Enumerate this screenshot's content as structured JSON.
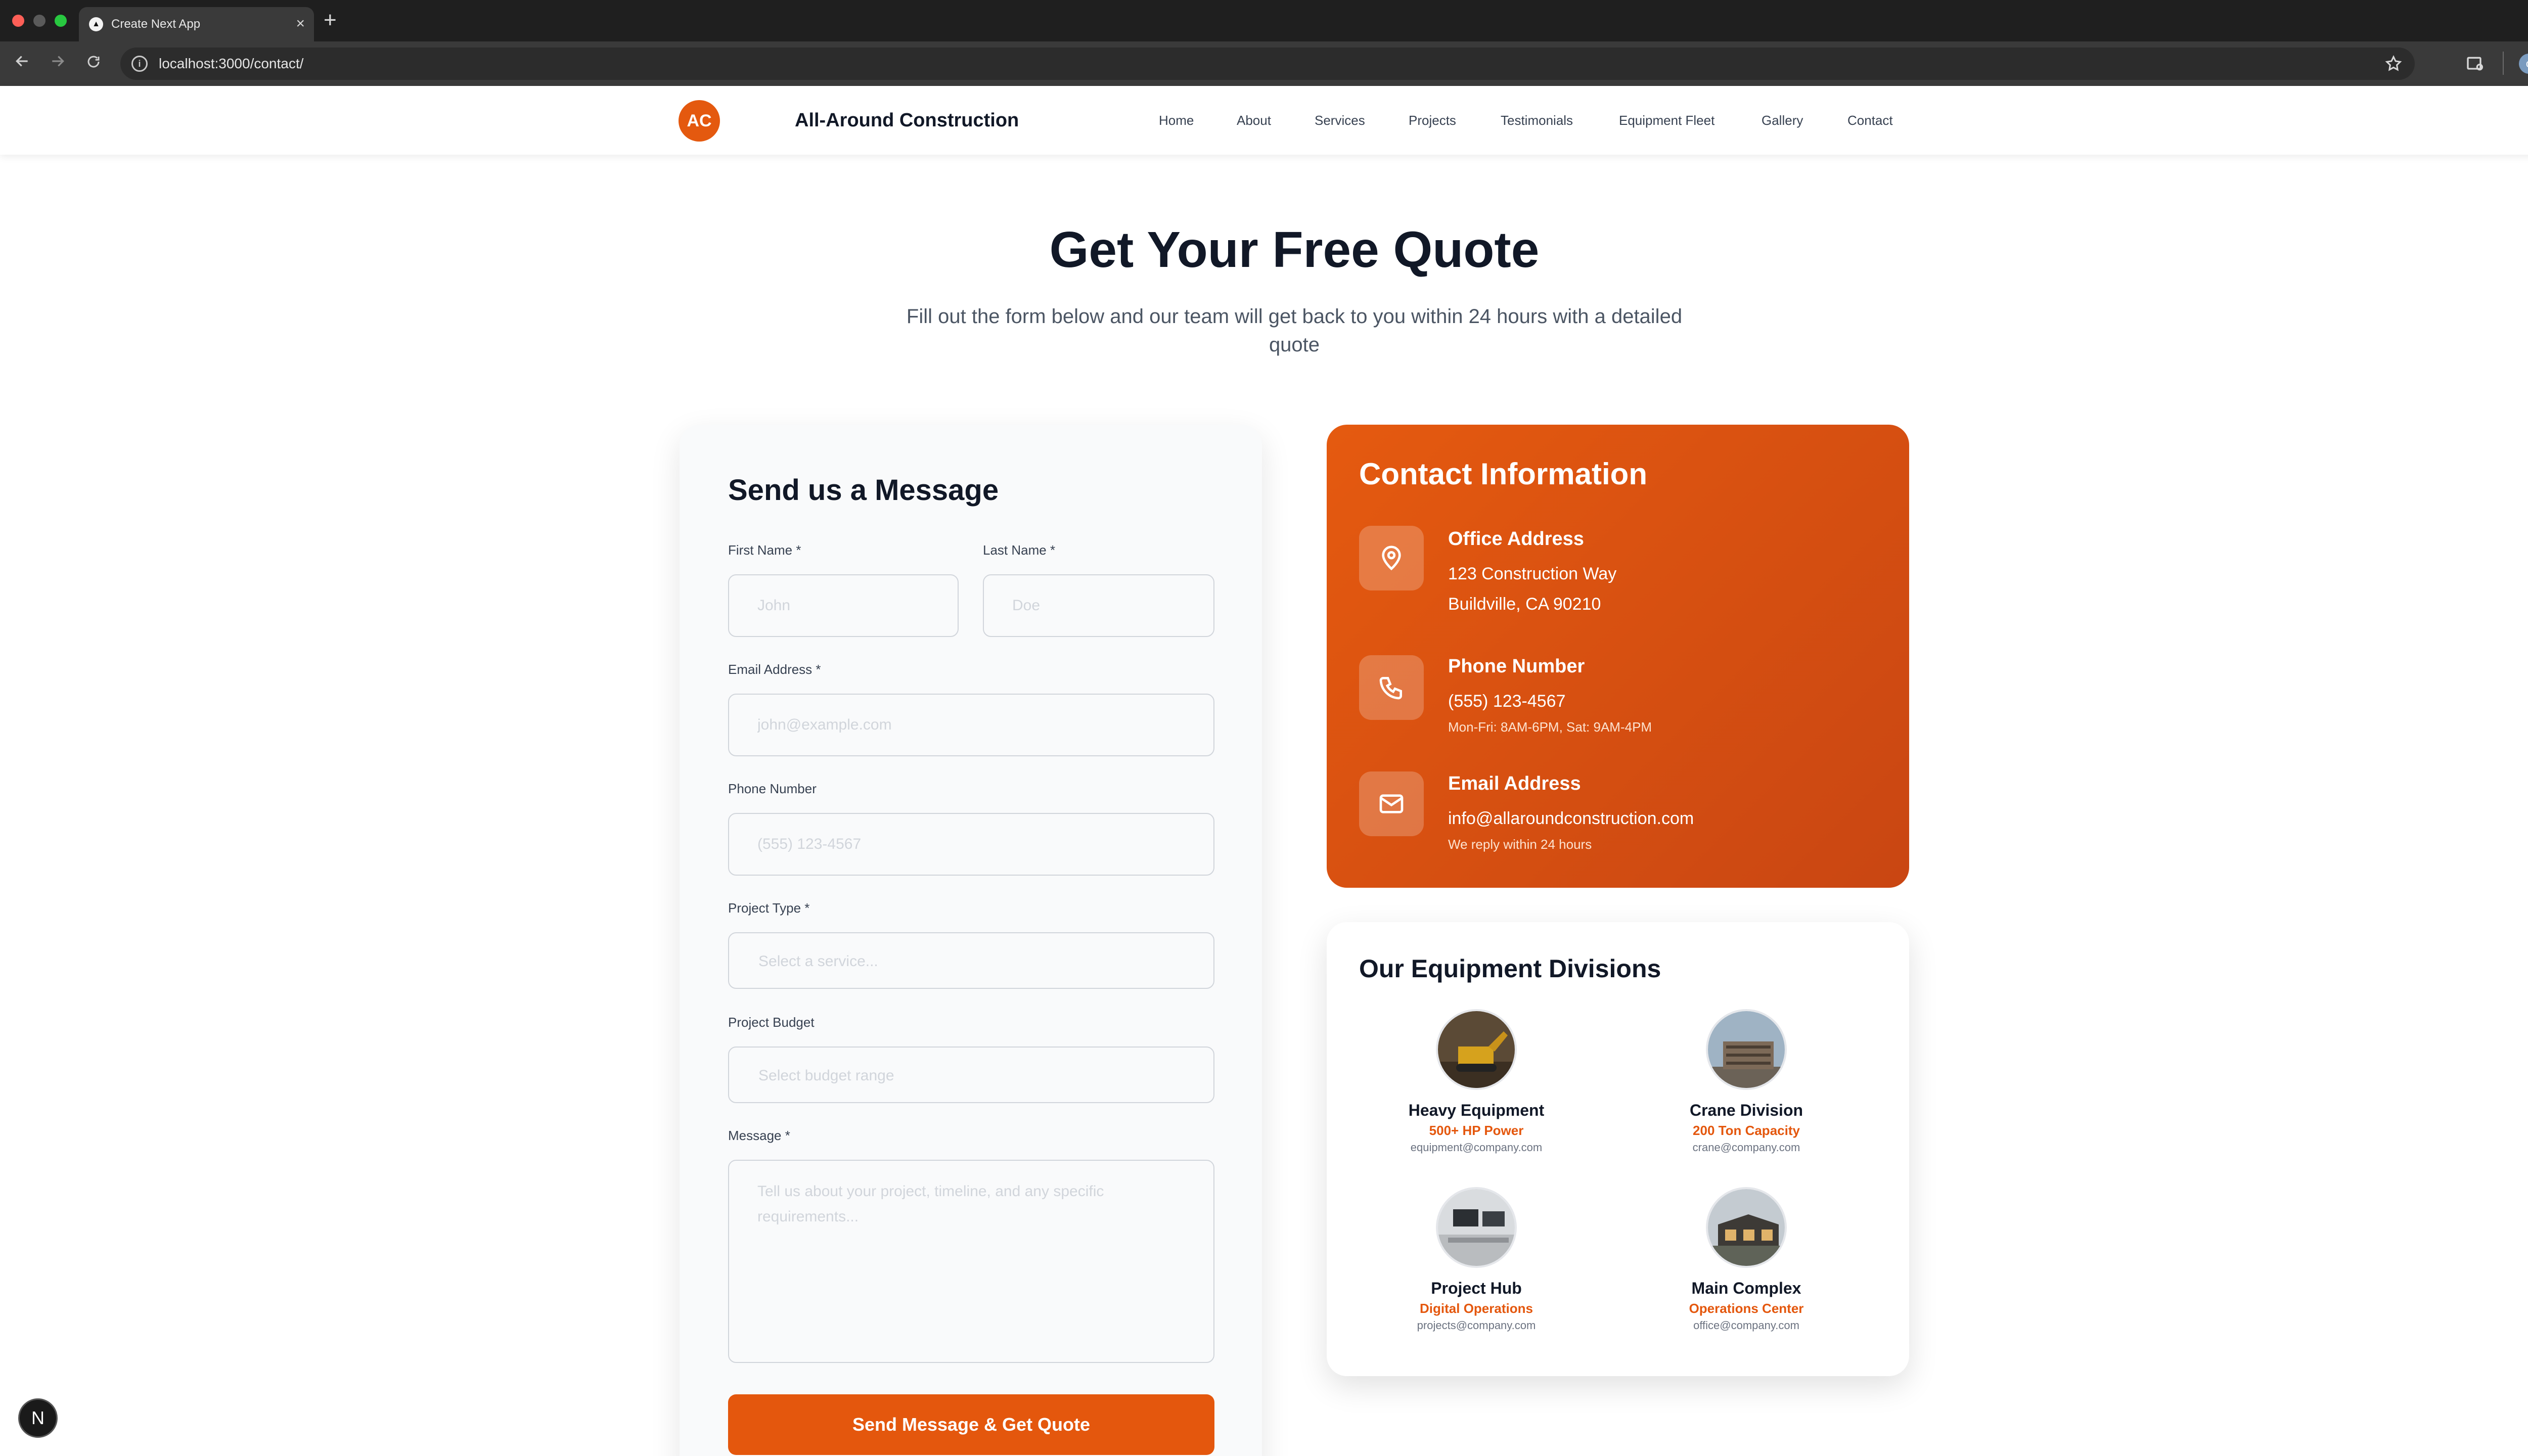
{
  "browser": {
    "tab_title": "Create Next App",
    "tab_favicon": "▲",
    "tab_close": "×",
    "new_tab": "+",
    "url": "localhost:3000/contact/",
    "profile_initial": "o"
  },
  "header": {
    "logo": "AC",
    "brand": "All-Around Construction",
    "nav": [
      "Home",
      "About",
      "Services",
      "Projects",
      "Testimonials",
      "Equipment Fleet",
      "Gallery",
      "Contact"
    ]
  },
  "hero": {
    "title": "Get Your Free Quote",
    "subtitle": "Fill out the form below and our team will get back to you within 24 hours with a detailed quote"
  },
  "form": {
    "title": "Send us a Message",
    "first_name": {
      "label": "First Name *",
      "placeholder": "John"
    },
    "last_name": {
      "label": "Last Name *",
      "placeholder": "Doe"
    },
    "email": {
      "label": "Email Address *",
      "placeholder": "john@example.com"
    },
    "phone": {
      "label": "Phone Number",
      "placeholder": "(555) 123-4567"
    },
    "project_type": {
      "label": "Project Type *",
      "selected": "Select a service..."
    },
    "budget": {
      "label": "Project Budget",
      "selected": "Select budget range"
    },
    "message": {
      "label": "Message *",
      "placeholder": "Tell us about your project, timeline, and any specific requirements..."
    },
    "submit": "Send Message & Get Quote"
  },
  "contact_info": {
    "title": "Contact Information",
    "office": {
      "heading": "Office Address",
      "line1": "123 Construction Way",
      "line2": "Buildville, CA 90210",
      "icon": "map-pin-icon"
    },
    "phone": {
      "heading": "Phone Number",
      "value": "(555) 123-4567",
      "hours": "Mon-Fri: 8AM-6PM, Sat: 9AM-4PM",
      "icon": "phone-icon"
    },
    "email": {
      "heading": "Email Address",
      "value": "info@allaroundconstruction.com",
      "note": "We reply within 24 hours",
      "icon": "mail-icon"
    }
  },
  "equipment": {
    "title": "Our Equipment Divisions",
    "divisions": [
      {
        "name": "Heavy Equipment",
        "stat": "500+ HP Power",
        "email": "equipment@company.com"
      },
      {
        "name": "Crane Division",
        "stat": "200 Ton Capacity",
        "email": "crane@company.com"
      },
      {
        "name": "Project Hub",
        "stat": "Digital Operations",
        "email": "projects@company.com"
      },
      {
        "name": "Main Complex",
        "stat": "Operations Center",
        "email": "office@company.com"
      }
    ]
  },
  "colors": {
    "accent": "#e4570d",
    "text": "#111827",
    "muted": "#4b5563"
  },
  "next_badge": "N"
}
